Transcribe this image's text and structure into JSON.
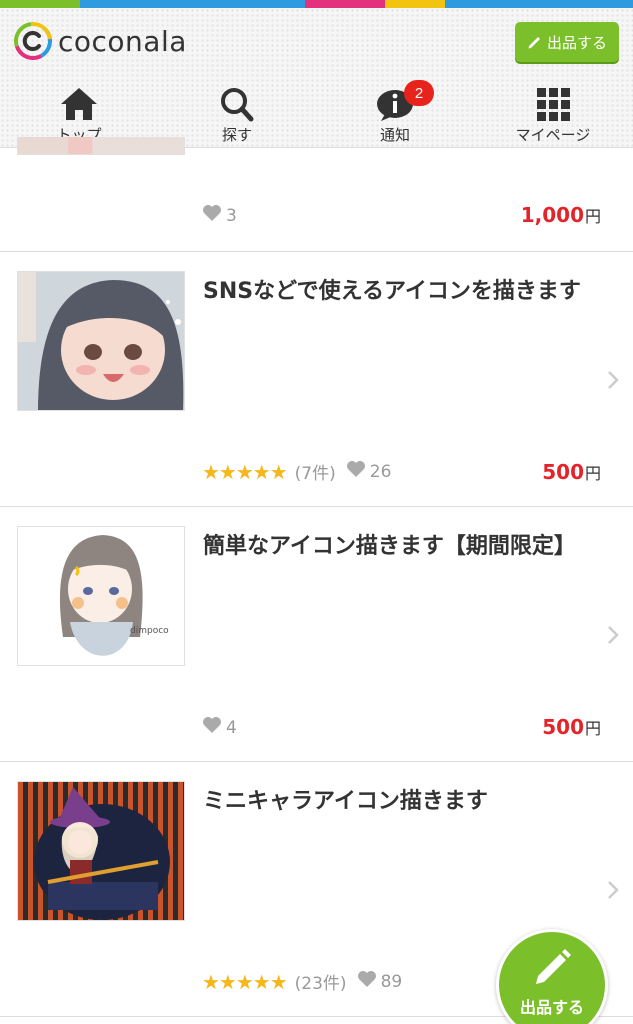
{
  "app": {
    "logo_text": "coconala",
    "sell_button": "出品する",
    "fab_label": "出品する"
  },
  "colors": {
    "accent_green": "#7bbf2a",
    "price_red": "#e3242b",
    "star": "#f5b71c",
    "badge_red": "#e8231b"
  },
  "nav": [
    {
      "label": "トップ",
      "icon": "home-icon"
    },
    {
      "label": "探す",
      "icon": "search-icon"
    },
    {
      "label": "通知",
      "icon": "info-bubble-icon",
      "badge": "2"
    },
    {
      "label": "マイページ",
      "icon": "grid-icon"
    }
  ],
  "listings": [
    {
      "title": "",
      "stars": "",
      "reviews": "",
      "likes": "3",
      "price": "1,000",
      "yen": "円"
    },
    {
      "title": "SNSなどで使えるアイコンを描きます",
      "stars": "★★★★★",
      "reviews": "(7件)",
      "likes": "26",
      "price": "500",
      "yen": "円"
    },
    {
      "title": "簡単なアイコン描きます【期間限定】",
      "stars": "",
      "reviews": "",
      "likes": "4",
      "price": "500",
      "yen": "円"
    },
    {
      "title": "ミニキャラアイコン描きます",
      "stars": "★★★★★",
      "reviews": "(23件)",
      "likes": "89",
      "price": "",
      "yen": ""
    }
  ]
}
